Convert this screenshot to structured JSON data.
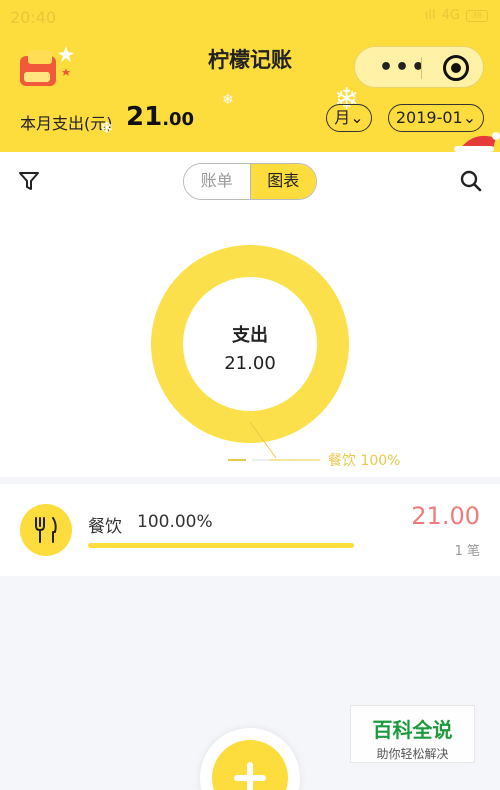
{
  "status_bar": {
    "time": "20:40",
    "network": "4G",
    "battery": "38"
  },
  "header": {
    "title": "柠檬记账",
    "month_label": "本月支出(元)",
    "month_amount_int": "21",
    "month_amount_dec": ".00",
    "period_select": "月",
    "date_select": "2019-01",
    "capsule_more": "•••"
  },
  "tabs": {
    "bills": "账单",
    "chart": "图表",
    "active": "chart"
  },
  "chart_data": {
    "type": "pie",
    "center_label": "支出",
    "center_value": "21.00",
    "slices": [
      {
        "name": "餐饮",
        "value": 21.0,
        "percent_label": "100%"
      }
    ]
  },
  "categories": [
    {
      "name": "餐饮",
      "percent": "100.00%",
      "fraction": 1.0,
      "amount": "21.00",
      "count": "1 笔"
    }
  ],
  "watermark": {
    "title": "百科全说",
    "subtitle": "助你轻松解决"
  },
  "colors": {
    "accent": "#fddc3d",
    "amount": "#f07b7b",
    "donut": "#fbe04b"
  }
}
